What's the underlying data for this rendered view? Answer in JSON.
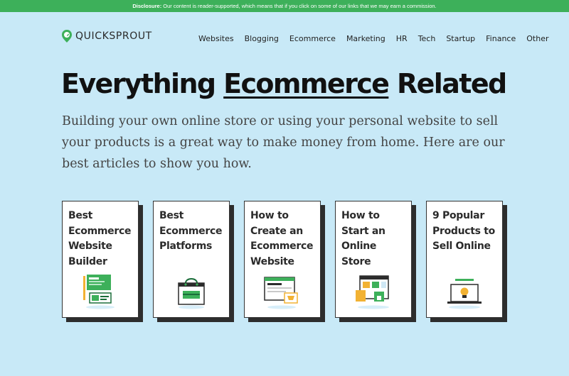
{
  "disclosure": {
    "label": "Disclosure:",
    "text": " Our content is reader-supported, which means that if you click on some of our links that we may earn a commission."
  },
  "brand": {
    "name": "QUICKSPROUT"
  },
  "nav": {
    "items": [
      "Websites",
      "Blogging",
      "Ecommerce",
      "Marketing",
      "HR",
      "Tech",
      "Startup",
      "Finance",
      "Other"
    ]
  },
  "hero": {
    "title_before": "Everything ",
    "title_highlight": "Ecommerce",
    "title_after": " Related",
    "subtitle": "Building your own online store or using your personal website to sell your products is a great way to make money from home. Here are our best articles to show you how."
  },
  "cards": [
    {
      "title": "Best Ecommerce Website Builder",
      "icon": "website-builder-icon"
    },
    {
      "title": "Best Ecommerce Platforms",
      "icon": "shopping-bag-icon"
    },
    {
      "title": "How to Create an Ecommerce Website",
      "icon": "browser-cart-icon"
    },
    {
      "title": "How to Start an Online Store",
      "icon": "online-store-icon"
    },
    {
      "title": "9 Popular Products to Sell Online",
      "icon": "laptop-lightbulb-icon"
    }
  ],
  "colors": {
    "accent": "#3db05a",
    "background": "#c8e9f7",
    "text": "#111111"
  }
}
